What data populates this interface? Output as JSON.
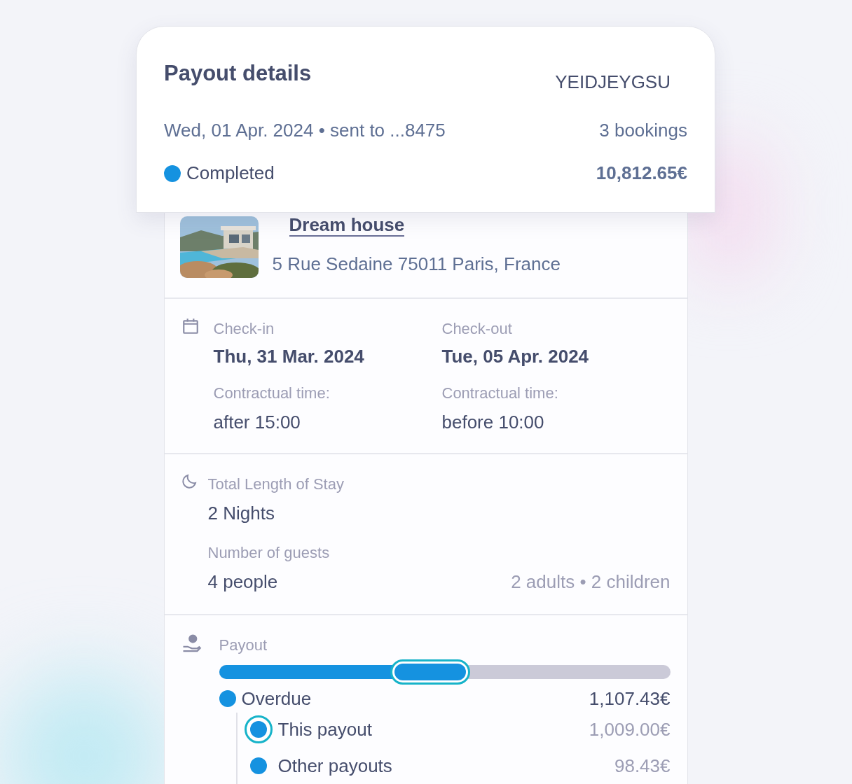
{
  "header": {
    "title": "Payout details",
    "reference": "YEIDJEYGSU",
    "date_line": "Wed, 01 Apr. 2024 • sent to ...8475",
    "bookings": "3 bookings",
    "status": {
      "label": "Completed",
      "color": "#1592e0"
    },
    "total": "10,812.65€"
  },
  "property": {
    "name": "Dream house",
    "address": "5 Rue Sedaine 75011 Paris, France"
  },
  "stay": {
    "check_in": {
      "label": "Check-in",
      "date": "Thu, 31 Mar. 2024",
      "time_label": "Contractual time:",
      "time": "after 15:00"
    },
    "check_out": {
      "label": "Check-out",
      "date": "Tue, 05 Apr. 2024",
      "time_label": "Contractual time:",
      "time": "before 10:00"
    }
  },
  "length": {
    "label": "Total Length of Stay",
    "value": "2 Nights",
    "guests_label": "Number of guests",
    "guests": "4 people",
    "guests_detail": "2 adults • 2 children"
  },
  "payout": {
    "label": "Payout",
    "bar": {
      "level": 0.55
    },
    "items": [
      {
        "label": "Overdue",
        "amount": "1,107.43€",
        "selected": false,
        "children": [
          {
            "label": "This payout",
            "amount": "1,009.00€",
            "selected": true
          },
          {
            "label": "Other payouts",
            "amount": "98.43€",
            "selected": false
          }
        ]
      }
    ]
  }
}
